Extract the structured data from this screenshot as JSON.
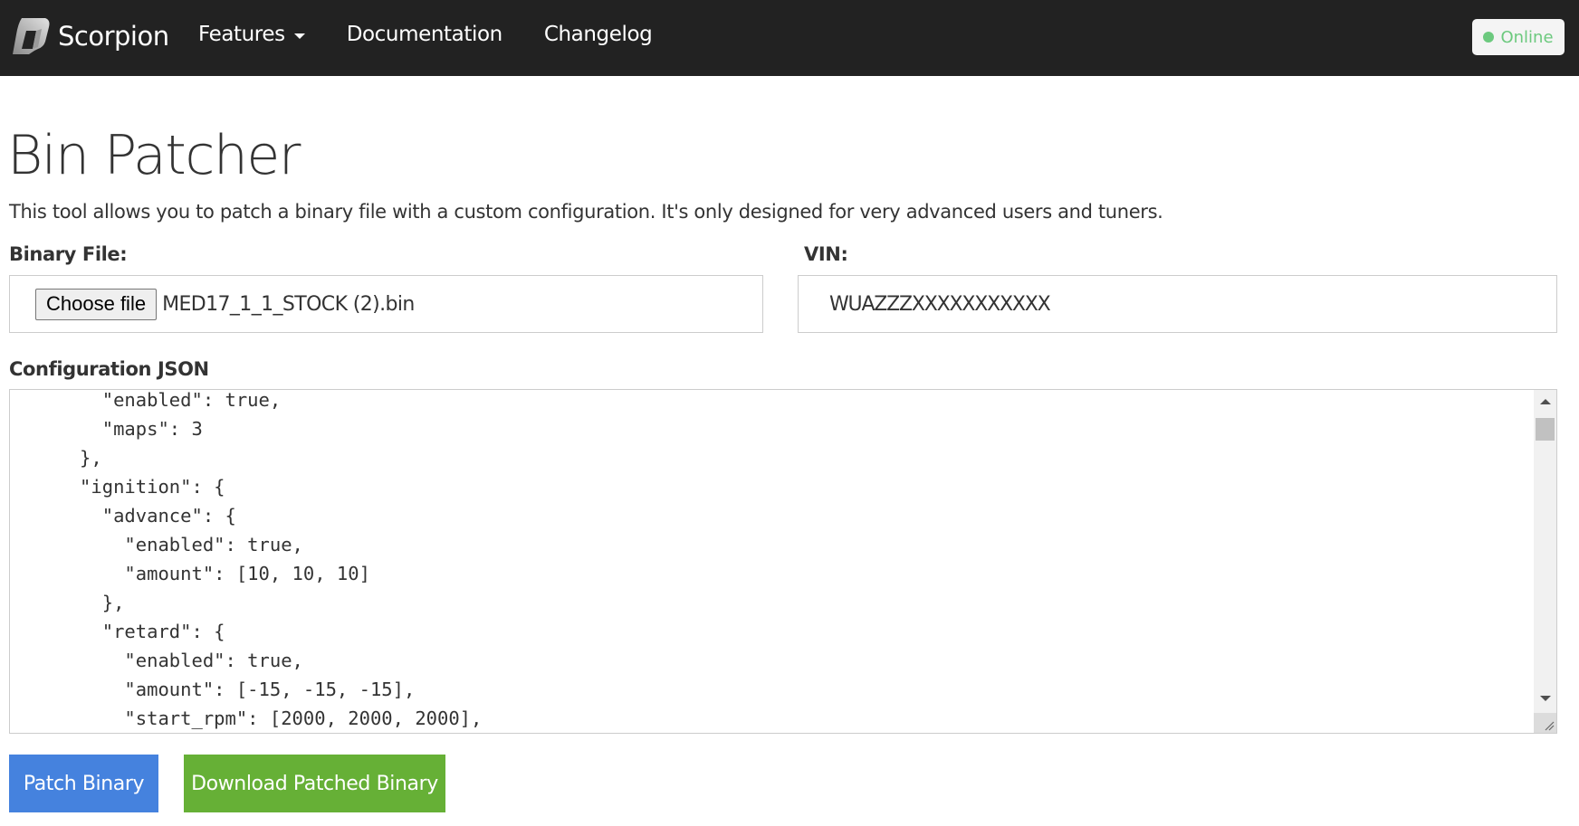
{
  "navbar": {
    "brand": {
      "name": "Scorpion",
      "logo_icon": "scorpion-logo-icon"
    },
    "links": [
      {
        "label": "Features",
        "has_dropdown": true
      },
      {
        "label": "Documentation",
        "has_dropdown": false
      },
      {
        "label": "Changelog",
        "has_dropdown": false
      }
    ],
    "status": {
      "label": "Online",
      "color": "#6cc97e"
    }
  },
  "page": {
    "title": "Bin Patcher",
    "description": "This tool allows you to patch a binary file with a custom configuration. It's only designed for very advanced users and tuners."
  },
  "form": {
    "binary_file": {
      "label": "Binary File:",
      "button_label": "Choose file",
      "file_name": "MED17_1_1_STOCK (2).bin"
    },
    "vin": {
      "label": "VIN:",
      "value": "WUAZZZXXXXXXXXXXX"
    },
    "config": {
      "label": "Configuration JSON",
      "lines": [
        "        \"enabled\": true,",
        "        \"maps\": 3",
        "      },",
        "      \"ignition\": {",
        "        \"advance\": {",
        "          \"enabled\": true,",
        "          \"amount\": [10, 10, 10]",
        "        },",
        "        \"retard\": {",
        "          \"enabled\": true,",
        "          \"amount\": [-15, -15, -15],",
        "          \"start_rpm\": [2000, 2000, 2000],"
      ]
    }
  },
  "actions": {
    "patch_label": "Patch Binary",
    "patch_color": "#4582de",
    "download_label": "Download Patched Binary",
    "download_color": "#66b036"
  }
}
